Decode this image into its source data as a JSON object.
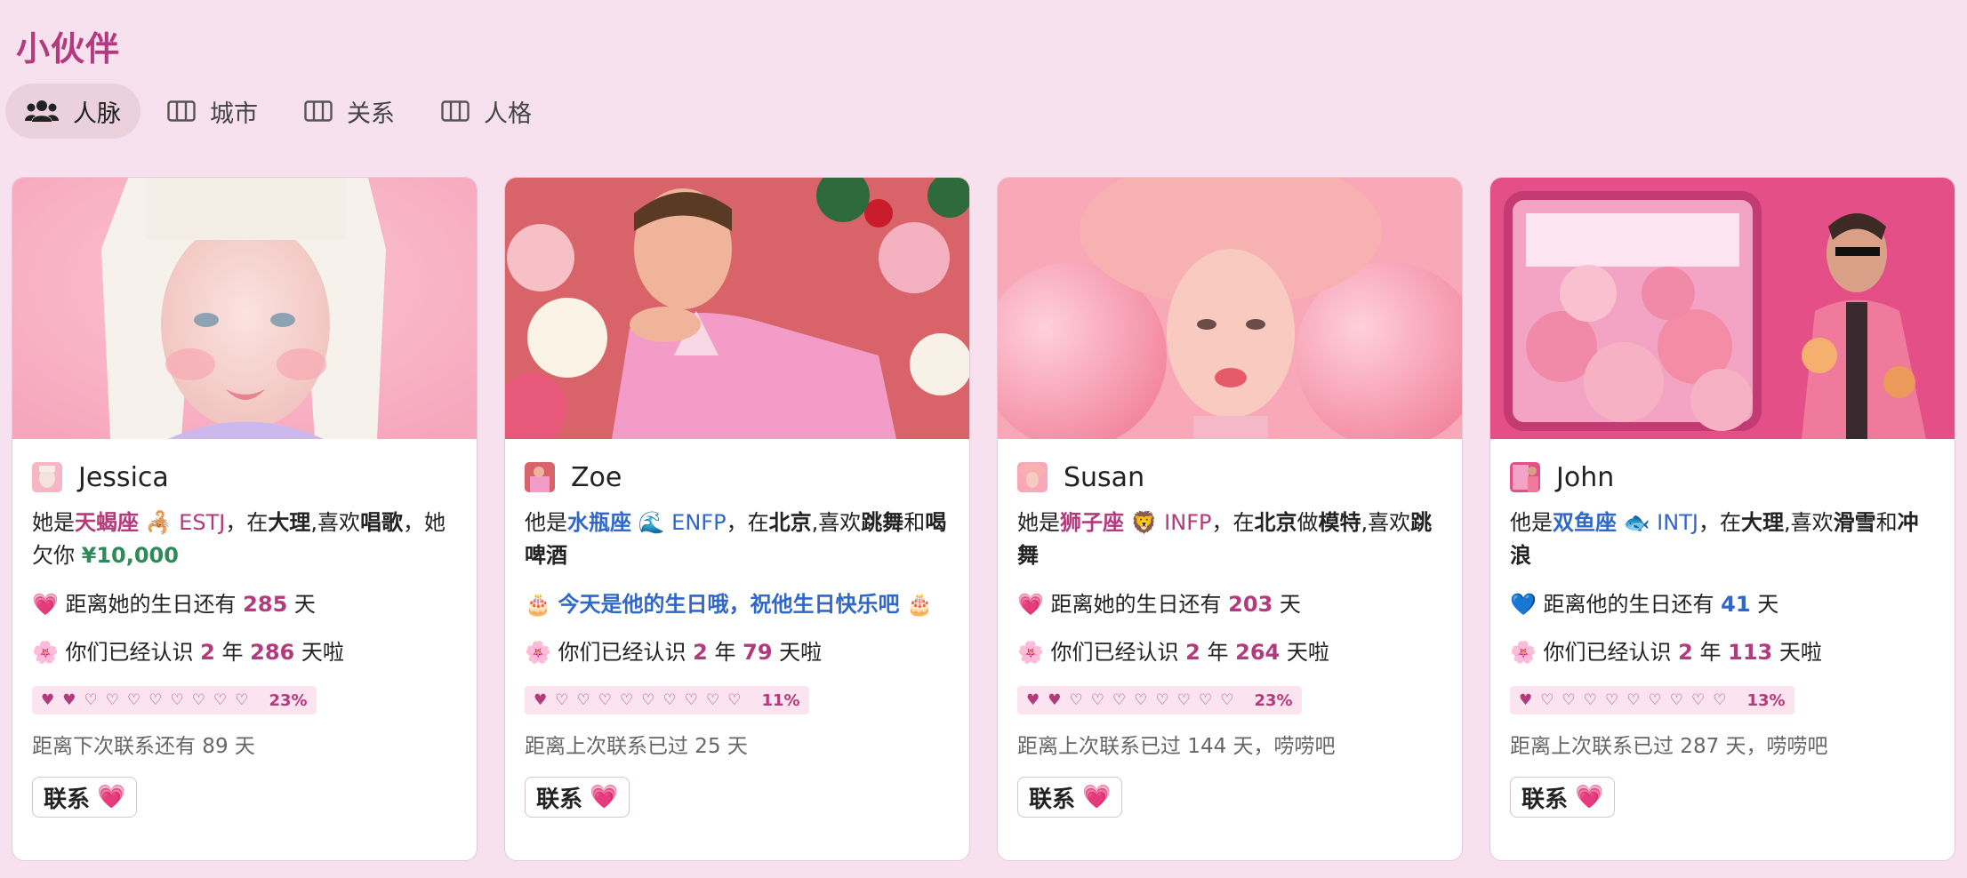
{
  "page": {
    "title": "小伙伴"
  },
  "tabs": [
    {
      "label": "人脉",
      "icon": "people-icon",
      "active": true
    },
    {
      "label": "城市",
      "icon": "columns-icon",
      "active": false
    },
    {
      "label": "关系",
      "icon": "columns-icon",
      "active": false
    },
    {
      "label": "人格",
      "icon": "columns-icon",
      "active": false
    }
  ],
  "colors": {
    "accent": "#b33a7c",
    "blue": "#2f68c9",
    "green": "#2e8a57",
    "background": "#f8e1ee"
  },
  "cards": [
    {
      "name": "Jessica",
      "desc": {
        "pronoun": "她是",
        "zodiac": "天蝎座",
        "zodiac_emoji": "🦂",
        "mbti": "ESTJ",
        "sep": "，在",
        "city": "大理",
        "likes_prefix": ",喜欢",
        "hobby1": "唱歌",
        "tail": "，她欠你 ",
        "money": "¥10,000"
      },
      "birthday": {
        "heart": "💗",
        "prefix": "距离她的生日还有 ",
        "days": "285",
        "suffix": " 天"
      },
      "known": {
        "emoji": "🌸",
        "prefix": "你们已经认识 ",
        "years": "2",
        "mid": " 年 ",
        "days": "286",
        "suffix": " 天啦"
      },
      "hearts": {
        "filled": 2,
        "total": 10,
        "pct": "23%"
      },
      "contact_note": "距离下次联系还有 89 天",
      "button": {
        "label": "联系",
        "emoji": "💗"
      }
    },
    {
      "name": "Zoe",
      "desc": {
        "pronoun": "他是",
        "zodiac": "水瓶座",
        "zodiac_emoji": "🌊",
        "mbti": "ENFP",
        "sep": "，在",
        "city": "北京",
        "likes_prefix": ",喜欢",
        "hobby1": "跳舞",
        "and": "和",
        "hobby2": "喝啤酒"
      },
      "birthday_today": {
        "emoji": "🎂",
        "text": "今天是他的生日哦，祝他生日快乐吧"
      },
      "known": {
        "emoji": "🌸",
        "prefix": "你们已经认识 ",
        "years": "2",
        "mid": " 年 ",
        "days": "79",
        "suffix": " 天啦"
      },
      "hearts": {
        "filled": 1,
        "total": 10,
        "pct": "11%"
      },
      "contact_note": "距离上次联系已过 25 天",
      "button": {
        "label": "联系",
        "emoji": "💗"
      }
    },
    {
      "name": "Susan",
      "desc": {
        "pronoun": "她是",
        "zodiac": "狮子座",
        "zodiac_emoji": "🦁",
        "mbti": "INFP",
        "sep": "，在",
        "city": "北京",
        "do": "做",
        "job": "模特",
        "likes_prefix": ",喜欢",
        "hobby1": "跳舞"
      },
      "birthday": {
        "heart": "💗",
        "prefix": "距离她的生日还有 ",
        "days": "203",
        "suffix": " 天"
      },
      "known": {
        "emoji": "🌸",
        "prefix": "你们已经认识 ",
        "years": "2",
        "mid": " 年 ",
        "days": "264",
        "suffix": " 天啦"
      },
      "hearts": {
        "filled": 2,
        "total": 10,
        "pct": "23%"
      },
      "contact_note": "距离上次联系已过 144 天，唠唠吧",
      "button": {
        "label": "联系",
        "emoji": "💗"
      }
    },
    {
      "name": "John",
      "desc": {
        "pronoun": "他是",
        "zodiac": "双鱼座",
        "zodiac_emoji": "🐟",
        "mbti": "INTJ",
        "sep": "，在",
        "city": "大理",
        "likes_prefix": ",喜欢",
        "hobby1": "滑雪",
        "and": "和",
        "hobby2": "冲浪"
      },
      "birthday": {
        "heart": "💙",
        "prefix": "距离他的生日还有 ",
        "days": "41",
        "suffix": " 天"
      },
      "known": {
        "emoji": "🌸",
        "prefix": "你们已经认识 ",
        "years": "2",
        "mid": " 年 ",
        "days": "113",
        "suffix": " 天啦"
      },
      "hearts": {
        "filled": 1,
        "total": 10,
        "pct": "13%"
      },
      "contact_note": "距离上次联系已过 287 天，唠唠吧",
      "button": {
        "label": "联系",
        "emoji": "💗"
      }
    }
  ]
}
